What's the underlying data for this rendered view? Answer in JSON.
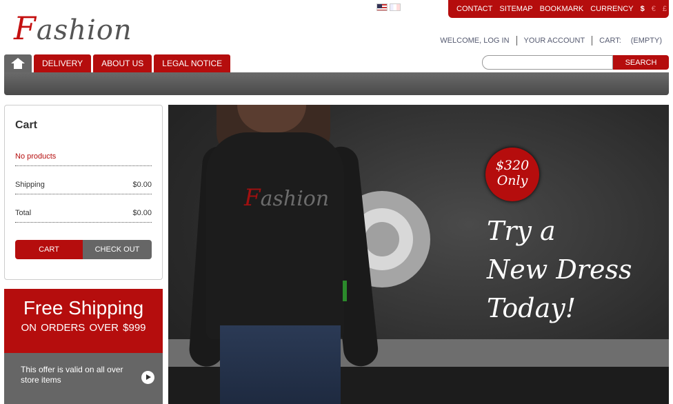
{
  "logo": {
    "first": "F",
    "rest": "ashion"
  },
  "topbar": {
    "links": [
      "CONTACT",
      "SITEMAP",
      "BOOKMARK",
      "CURRENCY"
    ],
    "currencies": [
      "$",
      "€",
      "£"
    ]
  },
  "userlinks": {
    "welcome": "WELCOME, LOG IN",
    "account": "YOUR ACCOUNT",
    "cart_label": "CART:",
    "cart_value": "(EMPTY)"
  },
  "nav": {
    "tabs": [
      "DELIVERY",
      "ABOUT US",
      "LEGAL NOTICE"
    ]
  },
  "search": {
    "value": "",
    "button": "SEARCH"
  },
  "cart": {
    "title": "Cart",
    "no_products": "No products",
    "shipping_label": "Shipping",
    "shipping_value": "$0.00",
    "total_label": "Total",
    "total_value": "$0.00",
    "cart_button": "CART",
    "checkout_button": "CHECK OUT"
  },
  "promo": {
    "big": "Free Shipping",
    "small": "ON ORDERS OVER $999",
    "offer": "This offer is valid on all over store items"
  },
  "banner": {
    "logo_first": "F",
    "logo_rest": "ashion",
    "price_line1": "$320",
    "price_line2": "Only",
    "slogan_1": "Try a",
    "slogan_2": "New Dress",
    "slogan_3": "Today!"
  }
}
